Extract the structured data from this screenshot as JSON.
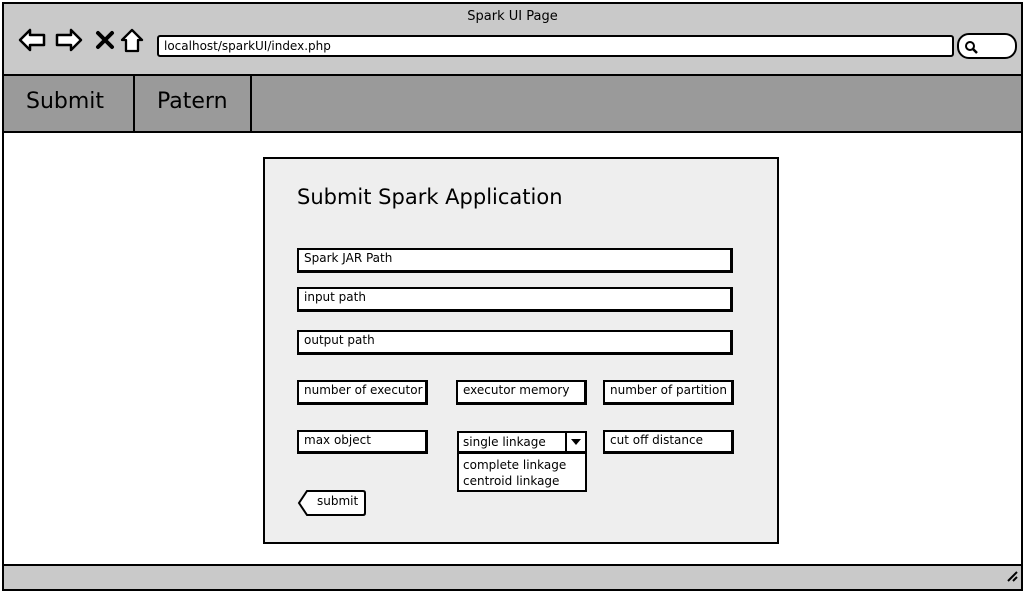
{
  "window": {
    "title": "Spark UI Page"
  },
  "browser": {
    "address": "localhost/sparkUI/index.php",
    "icons": [
      "back-arrow-icon",
      "forward-arrow-icon",
      "close-icon",
      "home-icon",
      "search-icon",
      "resize-grip-icon"
    ]
  },
  "nav": {
    "tabs": [
      {
        "label": "Submit"
      },
      {
        "label": "Patern"
      }
    ]
  },
  "form": {
    "title": "Submit Spark Application",
    "jar_path": "Spark JAR Path",
    "input_path": "input path",
    "output_path": "output path",
    "num_executor": "number of executor",
    "executor_memory": "executor memory",
    "num_partition": "number of partition",
    "max_object": "max object",
    "linkage": {
      "selected": "single linkage",
      "options": [
        "complete linkage",
        "centroid linkage"
      ]
    },
    "cutoff_distance": "cut off distance",
    "submit_label": "submit"
  },
  "colors": {
    "chrome": "#c9c9c9",
    "navbar": "#9a9a9a",
    "panel": "#eeeeee"
  }
}
